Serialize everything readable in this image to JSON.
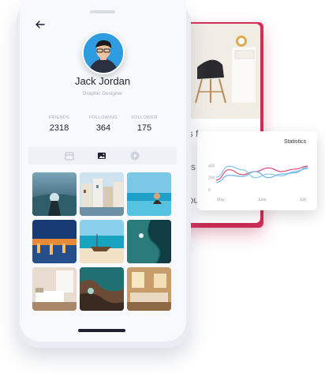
{
  "profile": {
    "name": "Jack Jordan",
    "role": "Graphic Designer",
    "stats": [
      {
        "label": "FRIENDS",
        "value": "2318"
      },
      {
        "label": "FOLLOWING",
        "value": "364"
      },
      {
        "label": "FOLLOWER",
        "value": "175"
      }
    ]
  },
  "tabs": [
    {
      "icon": "calendar-icon",
      "active": false
    },
    {
      "icon": "image-icon",
      "active": true
    },
    {
      "icon": "play-icon",
      "active": false
    }
  ],
  "gallery": [
    "hand-lake-photo",
    "coastal-houses-photo",
    "infinity-pool-photo",
    "harbor-lights-photo",
    "beach-boat-photo",
    "aerial-coast-photo",
    "bedroom-interior-photo",
    "rocky-shore-photo",
    "living-room-photo"
  ],
  "article_card": {
    "text_lines": [
      "es f",
      "nts",
      "bou"
    ]
  },
  "statistics": {
    "title": "Statistics"
  },
  "chart_data": {
    "type": "line",
    "title": "Statistics",
    "x": [
      "May",
      "June",
      "July"
    ],
    "ylim": [
      0,
      600
    ],
    "yticks": [
      "0",
      "200",
      "400"
    ],
    "series": [
      {
        "color": "#e2497a",
        "values": [
          160,
          330,
          250,
          300,
          360,
          300,
          340,
          390
        ]
      },
      {
        "color": "#7ec6ee",
        "values": [
          210,
          390,
          330,
          200,
          260,
          230,
          300,
          350
        ]
      },
      {
        "color": "#6fb2e8",
        "values": [
          120,
          240,
          220,
          300,
          200,
          260,
          280,
          370
        ]
      }
    ]
  },
  "colors": {
    "accent": "#d8315b",
    "text": "#1f2130",
    "muted": "#a5abb8"
  }
}
